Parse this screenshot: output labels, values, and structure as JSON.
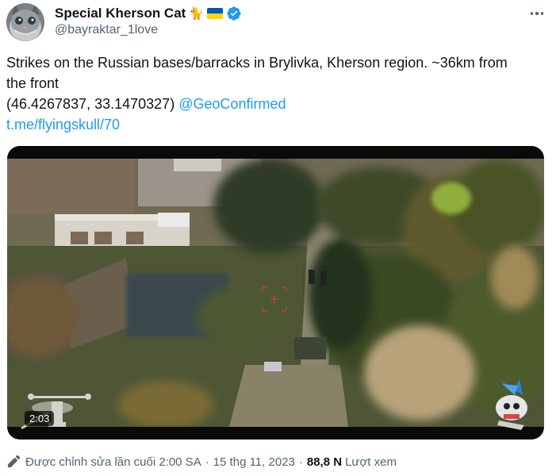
{
  "account": {
    "display_name": "Special Kherson Cat",
    "name_emoji": "🐈",
    "handle": "@bayraktar_1love"
  },
  "tweet": {
    "text_line1": "Strikes on the Russian bases/barracks in Brylivka, Kherson region. ~36km from",
    "text_line2": "the front",
    "coordinates": "(46.4267837, 33.1470327)",
    "mention": "@GeoConfirmed",
    "link": "t.me/flyingskull/70"
  },
  "media": {
    "duration": "2:03"
  },
  "footer": {
    "edited_label": "Được chỉnh sửa lần cuối 2:00 SA",
    "separator1": "·",
    "date": "15 thg 11, 2023",
    "separator2": "·",
    "views_count": "88,8 N",
    "views_label": "Lượt xem"
  },
  "icons": {
    "verified": "verified-badge-icon",
    "more": "more-options-icon",
    "edit": "pencil-icon",
    "flag": "ukraine-flag-icon"
  },
  "colors": {
    "link": "#1d9bf0",
    "secondary_text": "#536471",
    "primary_text": "#0f1419",
    "flag_blue": "#0057b7",
    "flag_yellow": "#ffd700"
  }
}
